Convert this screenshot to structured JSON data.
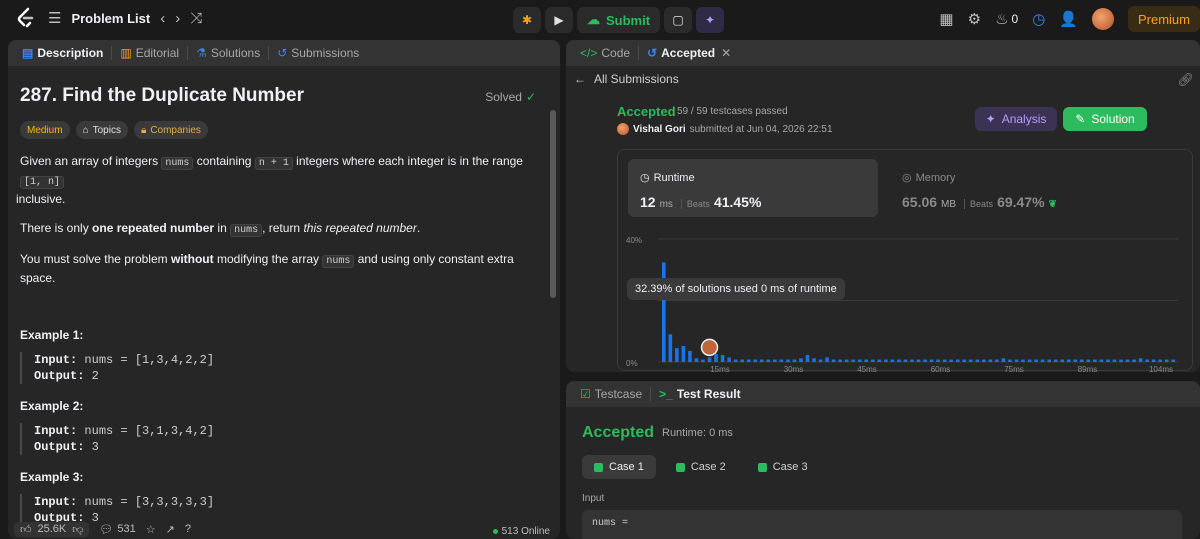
{
  "topbar": {
    "title": "Problem List",
    "submit_label": "Submit",
    "streak_count": "0",
    "premium_label": "Premium"
  },
  "left": {
    "tabs": [
      {
        "label": "Description"
      },
      {
        "label": "Editorial"
      },
      {
        "label": "Solutions"
      },
      {
        "label": "Submissions"
      }
    ],
    "problem_title": "287. Find the Duplicate Number",
    "solved_label": "Solved",
    "chips": [
      "Medium",
      "Topics",
      "Companies"
    ],
    "desc1_a": "Given an array of integers ",
    "desc1_code1": "nums",
    "desc1_b": " containing ",
    "desc1_code2": "n + 1",
    "desc1_c": " integers where each integer is in the range ",
    "desc1_code3": "[1, n]",
    "desc1_d": " inclusive.",
    "desc2_a": "There is only ",
    "desc2_b": "one repeated number",
    "desc2_c": " in ",
    "desc2_code": "nums",
    "desc2_d": ", return ",
    "desc2_e": "this repeated number",
    "desc2_f": ".",
    "desc3_a": "You must solve the problem ",
    "desc3_b": "without",
    "desc3_c": " modifying the array ",
    "desc3_code": "nums",
    "desc3_d": " and using only constant extra space.",
    "examples": [
      {
        "title": "Example 1:",
        "input": "nums = [1,3,4,2,2]",
        "output": "2"
      },
      {
        "title": "Example 2:",
        "input": "nums = [3,1,3,4,2]",
        "output": "3"
      },
      {
        "title": "Example 3:",
        "input": "nums = [3,3,3,3,3]",
        "output": "3"
      }
    ],
    "input_label": "Input:",
    "output_label": "Output:",
    "likes": "25.6K",
    "comments": "531",
    "online": "513 Online"
  },
  "right": {
    "tab_code": "Code",
    "tab_accepted": "Accepted",
    "all_submissions": "All Submissions",
    "accepted": "Accepted",
    "tests_passed": "59 / 59 testcases passed",
    "user_name": "Vishal Gori",
    "submitted_at": "submitted at Jun 04, 2026 22:51",
    "analysis_label": "Analysis",
    "solution_label": "Solution",
    "runtime_label": "Runtime",
    "runtime_value": "12",
    "runtime_unit": "ms",
    "beats_label": "Beats",
    "runtime_beats": "41.45%",
    "memory_label": "Memory",
    "memory_value": "65.06",
    "memory_unit": "MB",
    "memory_beats": "69.47%",
    "tooltip": "32.39% of solutions used 0 ms of runtime"
  },
  "chart_data": {
    "type": "bar",
    "y_ticks": [
      "40%",
      "0%"
    ],
    "x_ticks": [
      "15ms",
      "30ms",
      "45ms",
      "60ms",
      "75ms",
      "89ms",
      "104ms"
    ],
    "ylim": [
      0,
      40
    ],
    "values": [
      32.4,
      9,
      4.5,
      5.2,
      3.6,
      1.2,
      0.8,
      1.5,
      2.6,
      2.3,
      1.5,
      0.8,
      0.8,
      0.8,
      0.8,
      0.8,
      0.8,
      0.8,
      0.8,
      0.8,
      0.8,
      1.2,
      2.3,
      1.2,
      0.8,
      1.5,
      0.8,
      0.8,
      0.8,
      0.8,
      0.8,
      0.8,
      0.8,
      0.8,
      0.8,
      0.8,
      0.8,
      0.8,
      0.8,
      0.8,
      0.8,
      0.8,
      0.8,
      0.8,
      0.8,
      0.8,
      0.8,
      0.8,
      0.8,
      0.8,
      0.8,
      0.8,
      1.2,
      0.8,
      0.8,
      0.8,
      0.8,
      0.8,
      0.8,
      0.8,
      0.8,
      0.8,
      0.8,
      0.8,
      0.8,
      0.8,
      0.8,
      0.8,
      0.8,
      0.8,
      0.8,
      0.8,
      0.8,
      1.2,
      0.8,
      0.8,
      0.8,
      0.8,
      0.8
    ],
    "bar_color": "#1a73e8",
    "highlight_index": 7
  },
  "result": {
    "tab_testcase": "Testcase",
    "tab_result": "Test Result",
    "accepted": "Accepted",
    "runtime": "Runtime: 0 ms",
    "cases": [
      "Case 1",
      "Case 2",
      "Case 3"
    ],
    "input_label": "Input",
    "input_value": "nums ="
  }
}
